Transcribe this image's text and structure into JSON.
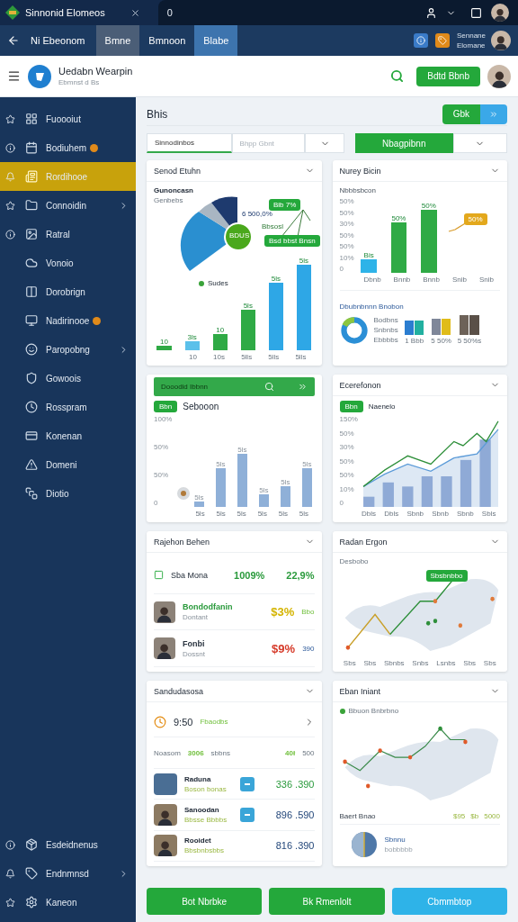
{
  "titlebar": {
    "title": "Sinnonid Elomeos",
    "address": "0"
  },
  "navbar": {
    "title": "Ni Ebeonom",
    "tabs": [
      {
        "label": "Bmne",
        "selected": false,
        "highlighted": true
      },
      {
        "label": "Bmnoon",
        "selected": false,
        "highlighted": false
      },
      {
        "label": "Blabe",
        "selected": true,
        "highlighted": false
      }
    ],
    "user": {
      "name": "Sennane",
      "role": "Elomane"
    }
  },
  "header": {
    "app_name": "Uedabn Wearpin",
    "subtitle": "Ebmnst d Bs",
    "button": "Bdtd Bbnb"
  },
  "sidebar": {
    "items": [
      {
        "label": "Fuoooiut",
        "selected": false,
        "badge": false,
        "submenu": false,
        "pinned": true
      },
      {
        "label": "Bodiuhem",
        "selected": false,
        "badge": true,
        "submenu": false,
        "pinned": true
      },
      {
        "label": "Rordihooe",
        "selected": true,
        "badge": false,
        "submenu": false,
        "pinned": true
      },
      {
        "label": "Connoidin",
        "selected": false,
        "badge": false,
        "submenu": true,
        "pinned": true
      },
      {
        "label": "Ratral",
        "selected": false,
        "badge": false,
        "submenu": false,
        "pinned": true
      },
      {
        "label": "Vonoio",
        "selected": false,
        "badge": false,
        "submenu": false,
        "pinned": false
      },
      {
        "label": "Dorobrign",
        "selected": false,
        "badge": false,
        "submenu": false,
        "pinned": false
      },
      {
        "label": "Nadirinooe",
        "selected": false,
        "badge": true,
        "submenu": false,
        "pinned": false
      },
      {
        "label": "Paropobng",
        "selected": false,
        "badge": false,
        "submenu": true,
        "pinned": false
      },
      {
        "label": "Gowoois",
        "selected": false,
        "badge": false,
        "submenu": false,
        "pinned": false
      },
      {
        "label": "Rosspram",
        "selected": false,
        "badge": false,
        "submenu": false,
        "pinned": false
      },
      {
        "label": "Konenan",
        "selected": false,
        "badge": false,
        "submenu": false,
        "pinned": false
      },
      {
        "label": "Domeni",
        "selected": false,
        "badge": false,
        "submenu": false,
        "pinned": false
      },
      {
        "label": "Diotio",
        "selected": false,
        "badge": false,
        "submenu": false,
        "pinned": false
      }
    ],
    "bottom_items": [
      {
        "label": "Esdeidnenus",
        "selected": false,
        "badge": false,
        "submenu": false,
        "pinned": true
      },
      {
        "label": "Endnmnsd",
        "selected": false,
        "badge": false,
        "submenu": true,
        "pinned": true
      },
      {
        "label": "Kaneon",
        "selected": false,
        "badge": false,
        "submenu": false,
        "pinned": true
      }
    ]
  },
  "main": {
    "title": "Bhis",
    "split_button": "Gbk",
    "filters": {
      "search": "Sinnodinbos",
      "placeholder": "Bhpp Gbnt",
      "select": "Nbagpibnn"
    }
  },
  "cards": [
    {
      "title": "Senod Etuhn",
      "heading": "Gunoncasn",
      "subheading": "Genbebs",
      "callouts": [
        "6 500,0%",
        "Bib 7%",
        "Bbsosl",
        "Bsd bbst Bnsn"
      ],
      "center": "BDUS",
      "legend": "Sudes",
      "bar_labels": [
        "10",
        "3ls",
        "10",
        "5ls",
        "5ls",
        "5ls"
      ],
      "x_labels": [
        "10",
        "10s",
        "5lls",
        "5lls",
        "5lls"
      ]
    },
    {
      "title": "Nurey Bicin",
      "axis_title": "Nbbbsbcon",
      "y_labels": [
        "50%",
        "50%",
        "30%",
        "50%",
        "50%",
        "10%",
        "0"
      ],
      "bar_labels": [
        "Bis",
        "50%",
        "50%"
      ],
      "callout": "50%",
      "x_labels": [
        "Dbnb",
        "Bnnb",
        "Bnnb",
        "Snib",
        "Snib"
      ],
      "section": "Dbubnbnnn Bnobon",
      "legend": [
        "Bodbns",
        "Snbnbs",
        "Ebbbbs"
      ],
      "group_labels": [
        "1 Bbb",
        "5 50%",
        "5 50%s"
      ]
    },
    {
      "title": "Dooodid Ibbnn",
      "pill": "Bbn",
      "heading": "Sebooon",
      "y_labels": [
        "100%",
        "50%",
        "50%",
        "0"
      ],
      "bar_labels": [
        "5ls",
        "5ls",
        "5ls",
        "5ls",
        "5ls",
        "5ls"
      ],
      "x_labels": [
        "5ls",
        "5ls",
        "5ls",
        "5ls",
        "5ls",
        "5ls"
      ]
    },
    {
      "title": "Ecerefonon",
      "pill": "Bbn",
      "legend": "Naenelo",
      "y_labels": [
        "150%",
        "50%",
        "30%",
        "50%",
        "50%",
        "10%",
        "0"
      ],
      "x_labels": [
        "Dbls",
        "Dbls",
        "Sbnb",
        "Sbnb",
        "Sbnb",
        "Sbls"
      ]
    },
    {
      "title": "Rajehon Behen",
      "summary": {
        "label": "Sba Mona",
        "value": "1009%",
        "change": "22,9%"
      },
      "people": [
        {
          "name": "Bondodfanin",
          "role": "Dontant",
          "value": "$3%",
          "extra": "Bbo",
          "color": "#d4b400",
          "kind": "featured"
        },
        {
          "name": "Fonbi",
          "role": "Dossnt",
          "value": "$9%",
          "extra": "390",
          "color": "#d63b2a",
          "kind": "regular"
        }
      ]
    },
    {
      "title": "Radan Ergon",
      "label": "Desbobo",
      "tag": "Sbsbnbbo",
      "x_labels": [
        "Sbs",
        "Sbs",
        "Sbnbs",
        "Snbs",
        "Lsnbs",
        "Sbs",
        "Sbs"
      ]
    },
    {
      "title": "Sandudasosa",
      "time": "9:50",
      "time_note": "Fbaodbs",
      "header_cells": [
        "Noasom",
        "3006",
        "sbbns",
        "40ł",
        "500"
      ],
      "rows": [
        {
          "name": "Raduna",
          "sub": "Boson bonas",
          "value": "336 .390",
          "color": "#2a9a3c",
          "kind": "landscape"
        },
        {
          "name": "Sanoodan",
          "sub": "Bbsse Bbbbs",
          "value": "896 .590",
          "color": "#23477a",
          "kind": "person"
        },
        {
          "name": "Rooidet",
          "sub": "Bbsbnbsbbs",
          "value": "816 .390",
          "color": "#23477a",
          "kind": "person"
        }
      ]
    },
    {
      "title": "Eban Iniant",
      "legend": "Bbuon Bnbrbno",
      "row": [
        "Baert Bnao",
        "$95",
        "$b",
        "5000"
      ],
      "footer_title": "Sbnnu",
      "footer_sub": "bobbbbb"
    }
  ],
  "buttons": [
    {
      "label": "Bot Nbrbke",
      "kind": "primary"
    },
    {
      "label": "Bk Rmenlolt",
      "kind": "primary"
    },
    {
      "label": "Cbmmbtop",
      "kind": "secondary"
    }
  ]
}
